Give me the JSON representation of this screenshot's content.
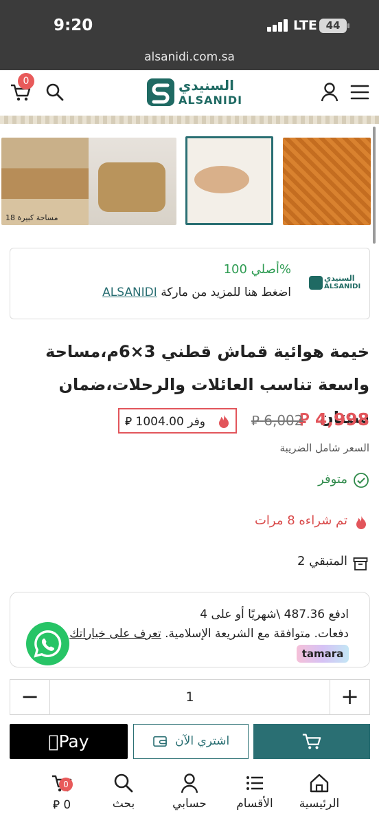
{
  "status_bar": {
    "time": "9:20",
    "network": "LTE",
    "battery": "44"
  },
  "browser": {
    "url": "alsanidi.com.sa"
  },
  "header": {
    "cart_count": "0",
    "logo_ar": "السنيدي",
    "logo_en": "ALSANIDI"
  },
  "gallery": {
    "thumb1_caption": "مساحة كبيرة 18"
  },
  "original_card": {
    "title": "أصلي 100%",
    "desc_prefix": "اضغط هنا للمزيد من ماركة",
    "brand_link": "ALSANIDI",
    "logo_ar": "السنيدي",
    "logo_en": "ALSANIDI"
  },
  "product": {
    "title": "خيمة هوائية قماش قطني 3×6م،مساحة واسعة تناسب العائلات والرحلات،ضمان سنتان",
    "price": "4,998",
    "old_price": "6,002",
    "save_label": "وفر 1004.00",
    "tax_note": "السعر شامل الضريبة",
    "availability": "متوفر",
    "purchased": "تم شراءه 8 مرات",
    "remaining": "المتبقي 2"
  },
  "tamara": {
    "line1": "ادفع 487.36 \\شهريًا أو على 4",
    "line2_prefix": "دفعات. متوافقة مع الشريعة الإسلامية.",
    "line2_link": "تعرف على خياراتك",
    "badge": "tamara"
  },
  "quantity": {
    "minus": "−",
    "value": "1",
    "plus": "+"
  },
  "actions": {
    "apple_pay": "Pay",
    "buy_now": "اشتري الآن"
  },
  "bottom_nav": {
    "home": "الرئيسية",
    "categories": "الأقسام",
    "account": "حسابي",
    "search": "بحث",
    "cart_total": "0",
    "cart_count": "0"
  },
  "colors": {
    "brand": "#2a6f73",
    "price_red": "#e2555b",
    "success_green": "#2f8a4a",
    "whatsapp": "#27c466"
  }
}
